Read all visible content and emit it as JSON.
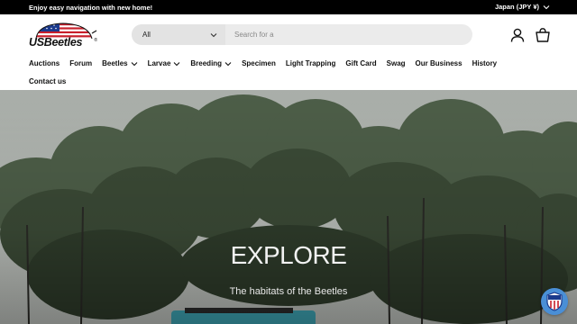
{
  "announcement": "Enjoy easy navigation with new home!",
  "currency": "Japan (JPY ¥)",
  "logo": {
    "text": "USBeetles",
    "registered": "®"
  },
  "search": {
    "category": "All",
    "placeholder": "Search for a"
  },
  "icons": {
    "account": "user-icon",
    "cart": "bag-icon"
  },
  "nav": {
    "items": [
      {
        "label": "Auctions",
        "dropdown": false
      },
      {
        "label": "Forum",
        "dropdown": false
      },
      {
        "label": "Beetles",
        "dropdown": true
      },
      {
        "label": "Larvae",
        "dropdown": true
      },
      {
        "label": "Breeding",
        "dropdown": true
      },
      {
        "label": "Specimen",
        "dropdown": false
      },
      {
        "label": "Light Trapping",
        "dropdown": false
      },
      {
        "label": "Gift Card",
        "dropdown": false
      },
      {
        "label": "Swag",
        "dropdown": false
      },
      {
        "label": "Our Business",
        "dropdown": false
      },
      {
        "label": "History",
        "dropdown": false
      }
    ],
    "contact": "Contact us"
  },
  "hero": {
    "title": "EXPLORE",
    "subtitle": "The habitats of the Beetles"
  },
  "colors": {
    "topbar": "#000000",
    "search_bg": "#ebebeb",
    "badge": "#4a8fd6"
  }
}
